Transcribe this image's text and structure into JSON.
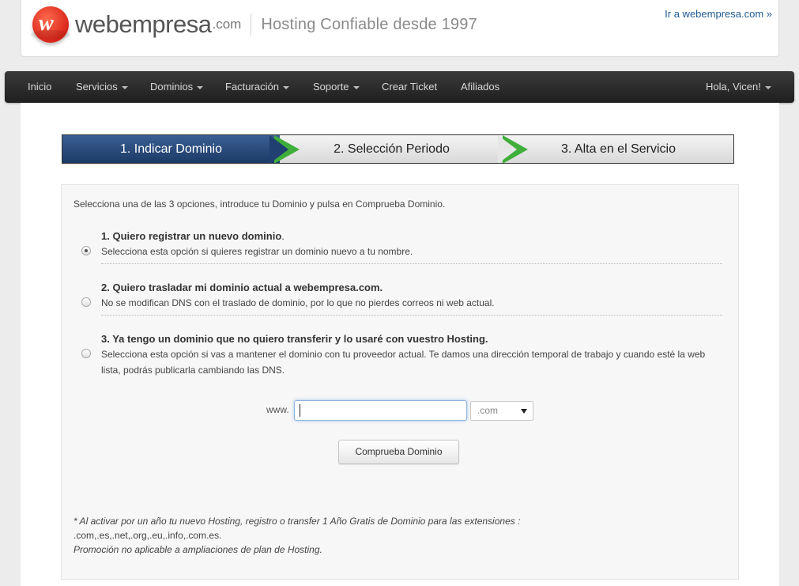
{
  "header": {
    "logo_letter": "w",
    "logo_text": "webempresa",
    "logo_suffix": ".com",
    "tagline": "Hosting Confiable desde 1997",
    "top_link": "Ir a webempresa.com »"
  },
  "nav": {
    "items": [
      {
        "label": "Inicio"
      },
      {
        "label": "Servicios"
      },
      {
        "label": "Dominios"
      },
      {
        "label": "Facturación"
      },
      {
        "label": "Soporte"
      },
      {
        "label": "Crear Ticket"
      },
      {
        "label": "Afiliados"
      }
    ],
    "user": "Hola, Vicen!"
  },
  "steps": [
    {
      "label": "1.  Indicar Dominio"
    },
    {
      "label": "2.  Selección Periodo"
    },
    {
      "label": "3.  Alta en el Servicio"
    }
  ],
  "form": {
    "intro": "Selecciona una de las 3 opciones, introduce tu Dominio y pulsa en Comprueba Dominio.",
    "options": [
      {
        "title": "1. Quiero registrar un nuevo dominio",
        "title_suffix": ".",
        "desc": "Selecciona esta opción si quieres registrar un dominio nuevo a tu nombre.",
        "checked": true
      },
      {
        "title": "2. Quiero trasladar mi dominio actual a webempresa.com.",
        "title_suffix": "",
        "desc": "No se modifican DNS con el traslado de dominio, por lo que no pierdes correos ni web actual.",
        "checked": false
      },
      {
        "title": "3. Ya tengo un dominio que no quiero transferir y lo usaré con vuestro Hosting.",
        "title_suffix": "",
        "desc": "Selecciona esta opción si vas a mantener el dominio con tu proveedor actual. Te damos una dirección temporal de trabajo y cuando esté la web lista, podrás publicarla cambiando las DNS.",
        "checked": false
      }
    ],
    "www_label": "www.",
    "domain_value": "",
    "tld_selected": ".com",
    "button_label": "Comprueba Dominio"
  },
  "footnote": {
    "line1": "* Al activar por un año tu nuevo Hosting, registro o transfer 1 Año Gratis de Dominio para las extensiones :",
    "line2": ".com,.es,.net,.org,.eu,.info,.com.es.",
    "line3": "Promoción no aplicable a ampliaciones de plan de Hosting."
  }
}
